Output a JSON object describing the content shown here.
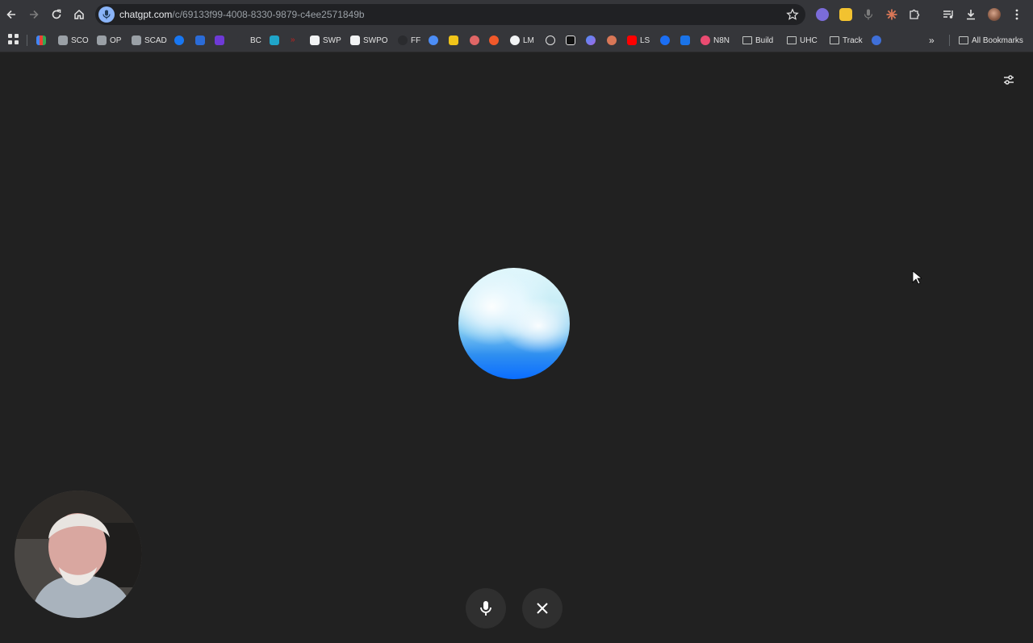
{
  "browser": {
    "url_host": "chatgpt.com",
    "url_path": "/c/69133f99-4008-8330-9879-c4ee2571849b",
    "nav_icons": [
      "back-arrow-icon",
      "forward-arrow-icon",
      "reload-icon",
      "home-icon"
    ],
    "toolbar_icons": [
      "extension-purple-icon",
      "extension-yellow-icon",
      "microphone-icon",
      "claude-icon",
      "extensions-puzzle-icon",
      "media-controls-icon",
      "download-icon",
      "profile-avatar",
      "menu-dots-icon"
    ]
  },
  "bookmarks": {
    "items": [
      {
        "label": "SCO"
      },
      {
        "label": "OP"
      },
      {
        "label": "SCAD"
      },
      {
        "label": "BC"
      },
      {
        "label": "SWP"
      },
      {
        "label": "SWPO"
      },
      {
        "label": "FF"
      },
      {
        "label": "LM"
      },
      {
        "label": "LS"
      },
      {
        "label": "N8N"
      },
      {
        "label": "Build"
      },
      {
        "label": "UHC"
      },
      {
        "label": "Track"
      }
    ],
    "overflow": "»",
    "all_bookmarks": "All Bookmarks"
  },
  "voice": {
    "orb_colors": {
      "top": "#dff6fb",
      "bottom": "#0a6dff"
    },
    "mic_icon": "microphone-icon",
    "close_icon": "close-icon",
    "settings_icon": "sliders-icon"
  }
}
